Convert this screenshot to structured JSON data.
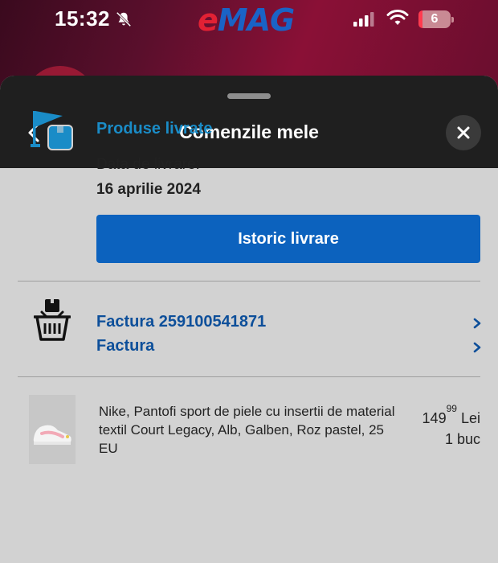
{
  "status_bar": {
    "time": "15:32",
    "battery_level": "6",
    "icons": [
      "bell-off-icon",
      "signal-icon",
      "wifi-icon",
      "battery-icon"
    ]
  },
  "app": {
    "logo_e": "e",
    "logo_mag": "MAG"
  },
  "sheet": {
    "title": "Comenzile mele",
    "icons": [
      "back-arrow-icon",
      "close-icon"
    ]
  },
  "delivery": {
    "icon": "flag-package-icon",
    "status": "Produse livrate",
    "date_label": "Data de livrare:",
    "date": "16 aprilie 2024",
    "history_button": "Istoric livrare"
  },
  "invoice": {
    "icon": "basket-icon",
    "links": [
      "Factura 259100541871",
      "Factura"
    ],
    "chevron_icon": "chevron-right-icon"
  },
  "product": {
    "name": "Nike, Pantofi sport de piele cu insertii de material textil Court Legacy, Alb, Galben, Roz pastel, 25 EU",
    "price_main": "149",
    "price_cents": "99",
    "currency": "Lei",
    "quantity": "1 buc"
  },
  "colors": {
    "accent_blue": "#0c62be",
    "status_blue": "#1a8cc7",
    "link_blue": "#0d4f9a",
    "header_dark": "#1f1f1f",
    "body_grey": "#d2d2d2"
  }
}
